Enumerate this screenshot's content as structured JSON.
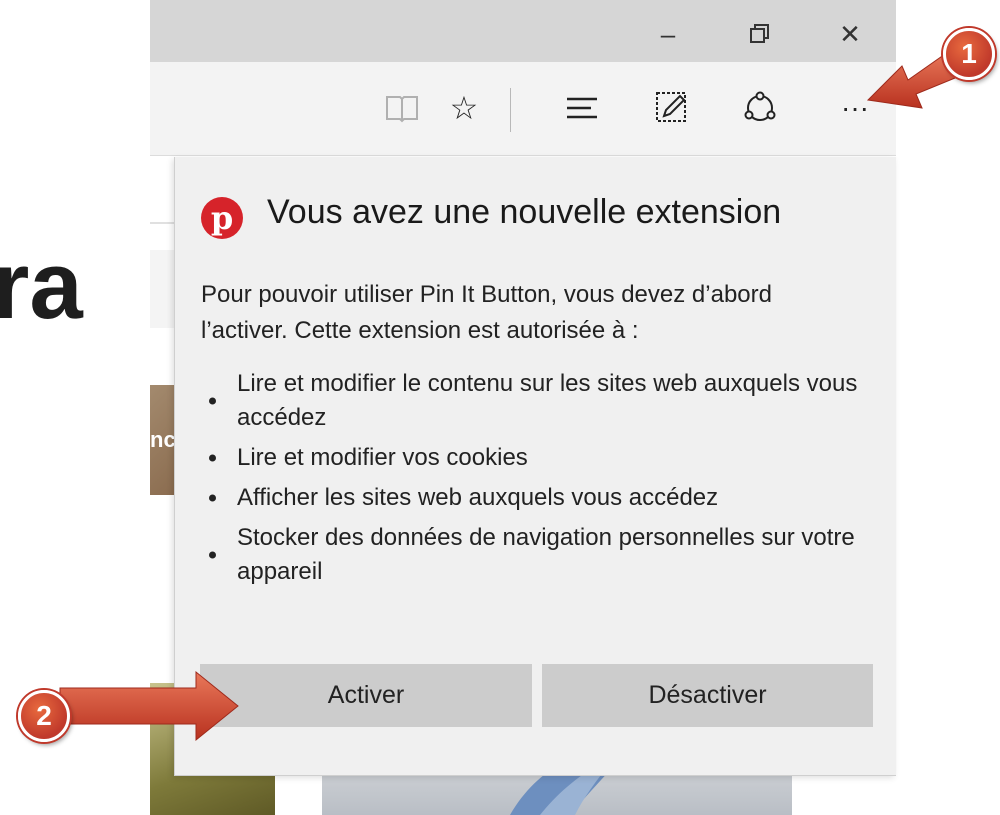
{
  "background": {
    "partial_word": "ra",
    "partial_image_text": "nc"
  },
  "window_controls": {
    "minimize": "–",
    "restore": "🗗",
    "close": "✕"
  },
  "toolbar": {
    "icons": [
      "reading-view-icon",
      "favorite-star-icon",
      "hub-icon",
      "web-note-icon",
      "share-icon",
      "more-icon"
    ],
    "favorite_glyph": "☆",
    "hub_glyph": "≡",
    "more_glyph": "···"
  },
  "popup": {
    "title": "Vous avez une nouvelle extension",
    "logo_letter": "p",
    "description": "Pour pouvoir utiliser Pin It Button, vous devez d’abord l’activer. Cette extension est autorisée à :",
    "permissions": [
      "Lire et modifier le contenu sur les sites web auxquels vous accédez",
      "Lire et modifier vos cookies",
      "Afficher les sites web auxquels vous accédez",
      "Stocker des données de navigation personnelles sur votre appareil"
    ],
    "activate_label": "Activer",
    "deactivate_label": "Désactiver"
  },
  "callouts": {
    "one": "1",
    "two": "2"
  },
  "colors": {
    "callout_red": "#c0392b",
    "pinterest_red": "#d6232a",
    "button_gray": "#cccccc",
    "popup_bg": "#f0f0f0"
  }
}
